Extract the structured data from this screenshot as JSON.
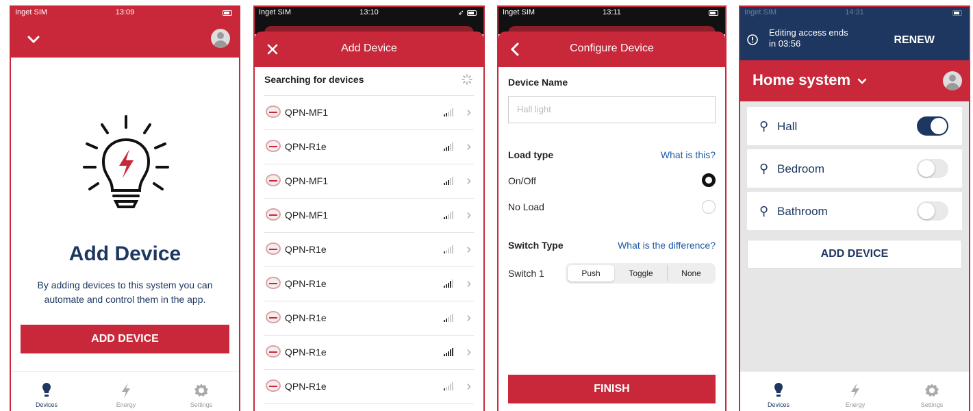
{
  "colors": {
    "brand_red": "#c8283a",
    "navy": "#1d3760",
    "link_blue": "#1d5aa8"
  },
  "tabs": {
    "devices": "Devices",
    "energy": "Energy",
    "settings": "Settings"
  },
  "screen1": {
    "status": {
      "carrier": "Inget SIM",
      "time": "13:09"
    },
    "title": "Add Device",
    "description_line1": "By adding devices to this system you can",
    "description_line2": "automate and control them in the app.",
    "add_button": "ADD DEVICE"
  },
  "screen2": {
    "status": {
      "carrier": "Inget SIM",
      "time": "13:10"
    },
    "title": "Add Device",
    "close_icon": "close-icon",
    "searching": "Searching for devices",
    "devices": [
      {
        "name": "QPN-MF1",
        "signal": 2
      },
      {
        "name": "QPN-R1e",
        "signal": 3
      },
      {
        "name": "QPN-MF1",
        "signal": 3
      },
      {
        "name": "QPN-MF1",
        "signal": 2
      },
      {
        "name": "QPN-R1e",
        "signal": 1
      },
      {
        "name": "QPN-R1e",
        "signal": 4
      },
      {
        "name": "QPN-R1e",
        "signal": 2
      },
      {
        "name": "QPN-R1e",
        "signal": 5
      },
      {
        "name": "QPN-R1e",
        "signal": 1
      }
    ]
  },
  "screen3": {
    "status": {
      "carrier": "Inget SIM",
      "time": "13:11"
    },
    "title": "Configure Device",
    "device_name_label": "Device Name",
    "device_name_placeholder": "Hall light",
    "load_type_label": "Load type",
    "load_type_link": "What is this?",
    "option_onoff": "On/Off",
    "option_noload": "No Load",
    "selected_load": "On/Off",
    "switch_type_label": "Switch Type",
    "switch_type_link": "What is the difference?",
    "switch1_label": "Switch 1",
    "switch_options": [
      "Push",
      "Toggle",
      "None"
    ],
    "switch_selected": "Push",
    "finish_button": "FINISH"
  },
  "screen4": {
    "status": {
      "carrier": "Inget SIM",
      "time": "14:31"
    },
    "editing_line1": "Editing access ends",
    "editing_line2": "in 03:56",
    "renew": "RENEW",
    "system_title": "Home system",
    "rooms": [
      {
        "name": "Hall",
        "on": true
      },
      {
        "name": "Bedroom",
        "on": false
      },
      {
        "name": "Bathroom",
        "on": false
      }
    ],
    "add_device": "ADD DEVICE"
  }
}
